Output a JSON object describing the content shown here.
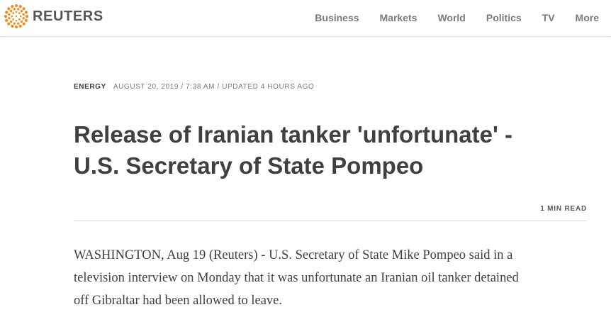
{
  "header": {
    "logo_text": "REUTERS",
    "nav": [
      "Business",
      "Markets",
      "World",
      "Politics",
      "TV",
      "More"
    ]
  },
  "article": {
    "channel": "ENERGY",
    "dateline": "AUGUST 20, 2019 / 7:38 AM / UPDATED 4 HOURS AGO",
    "headline_line1": "Release of Iranian tanker 'unfortunate' -",
    "headline_line2": "U.S. Secretary of State Pompeo",
    "read_time": "1 MIN READ",
    "body_line1": "WASHINGTON, Aug 19 (Reuters) - U.S. Secretary of State Mike Pompeo said in a",
    "body_line2": "television interview on Monday that it was unfortunate an Iranian oil tanker detained",
    "body_line3": "off Gibraltar had been allowed to leave."
  },
  "colors": {
    "logo_orange": "#f28b21",
    "text_dark": "#404040",
    "text_muted": "#7a7a7a"
  }
}
